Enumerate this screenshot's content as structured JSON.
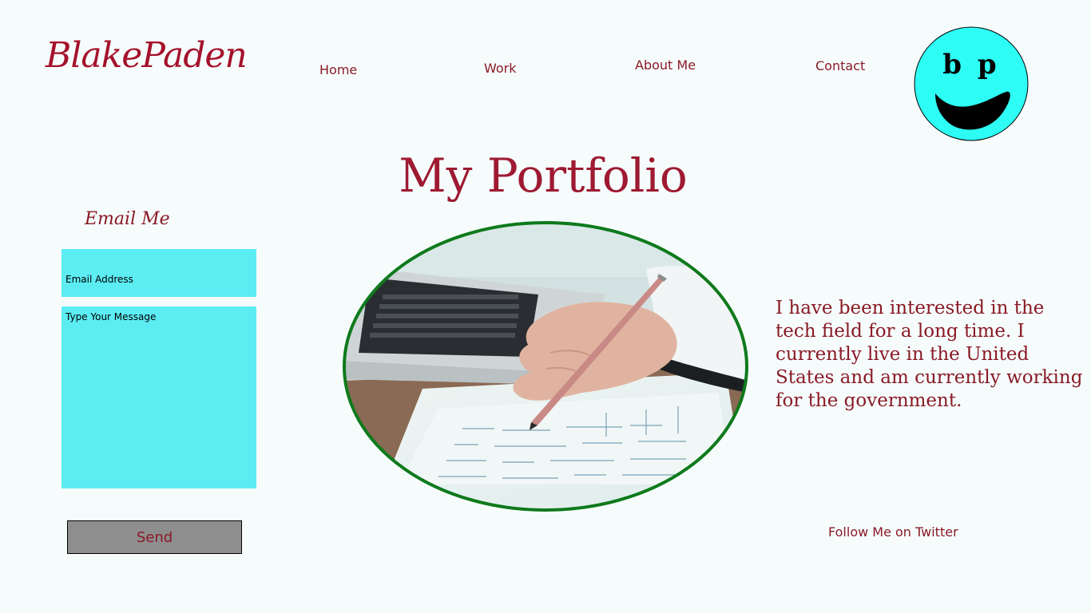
{
  "site": {
    "logo_text": "BlakePaden",
    "brand_color": "#a5122b"
  },
  "nav": {
    "items": [
      {
        "label": "Home"
      },
      {
        "label": "Work"
      },
      {
        "label": "About Me"
      },
      {
        "label": "Contact"
      }
    ]
  },
  "avatar": {
    "initials": "b p",
    "face_color": "#2efdf5",
    "icon": "smiley-face-icon"
  },
  "main": {
    "title": "My Portfolio",
    "hero_image": "laptop-and-pencil-desk-photo",
    "hero_border_color": "#0e7a1c",
    "bio": "I have been interested in the tech field for a long time. I currently live in the United States and am currently working for the government."
  },
  "contact_form": {
    "heading": "Email Me",
    "email_placeholder": "Email Address",
    "email_value": "",
    "message_placeholder": "Type Your Message",
    "message_value": "",
    "field_color": "#5cedf3",
    "send_label": "Send"
  },
  "social": {
    "twitter_label": "Follow Me on Twitter"
  }
}
